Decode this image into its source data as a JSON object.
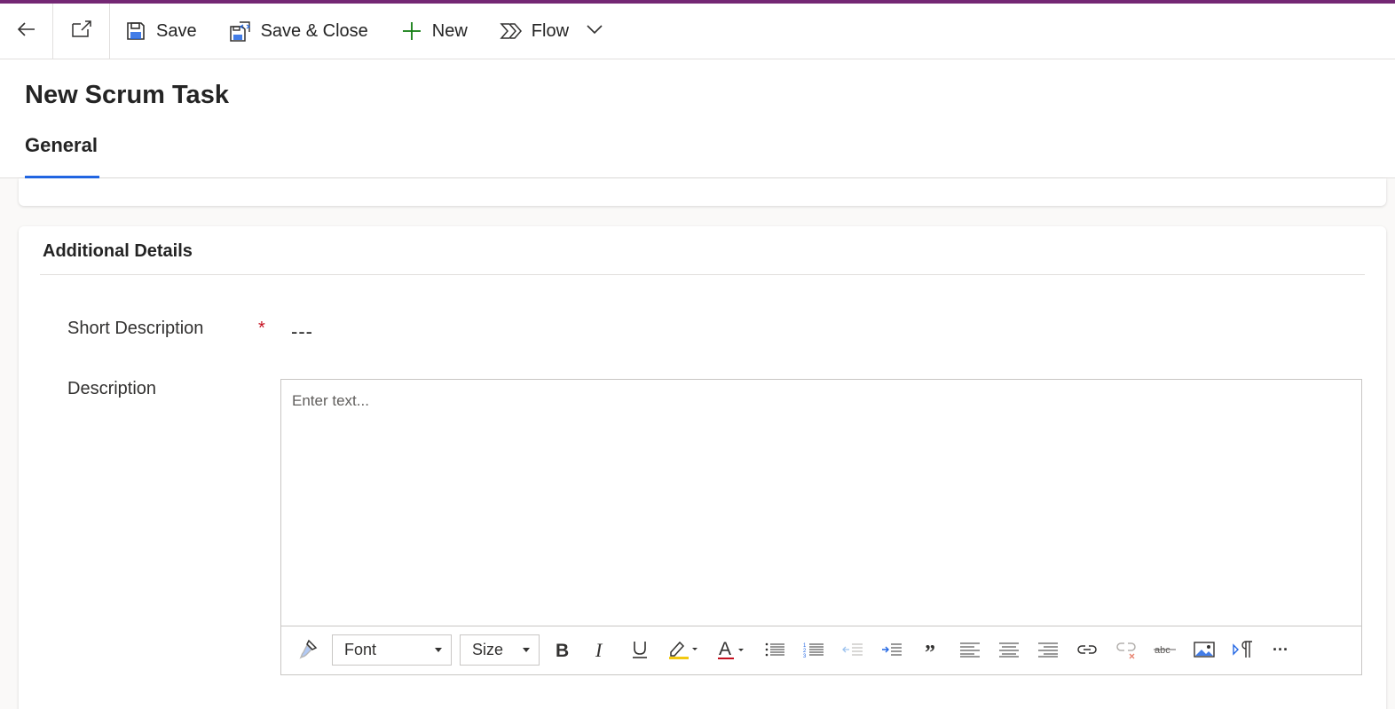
{
  "commandbar": {
    "back_icon": "arrow-left-icon",
    "popout_icon": "open-in-new-window-icon",
    "save_label": "Save",
    "save_close_label": "Save & Close",
    "new_label": "New",
    "flow_label": "Flow"
  },
  "colors": {
    "accent_bar": "#742774",
    "tab_underline": "#2266e3",
    "required": "#c50f1f",
    "new_icon": "#107c10"
  },
  "header": {
    "title": "New Scrum Task",
    "tabs": [
      {
        "label": "General",
        "selected": true
      }
    ]
  },
  "section": {
    "title": "Additional Details",
    "fields": {
      "short_description": {
        "label": "Short Description",
        "required_mark": "*",
        "value": "---"
      },
      "description": {
        "label": "Description",
        "placeholder": "Enter text..."
      }
    }
  },
  "editor_toolbar": {
    "font_label": "Font",
    "size_label": "Size",
    "more_label": "···"
  }
}
